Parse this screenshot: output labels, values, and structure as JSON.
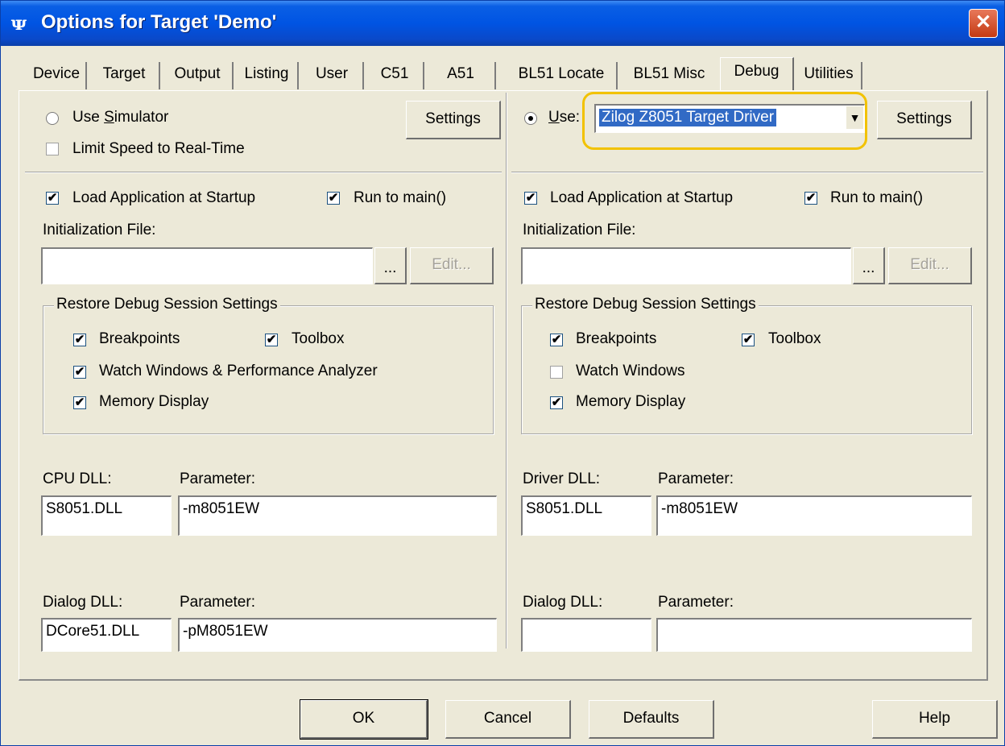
{
  "window": {
    "title": "Options for Target 'Demo'",
    "app_icon": "uv-icon",
    "close_glyph": "✕"
  },
  "tabs": [
    {
      "label": "Device"
    },
    {
      "label": "Target"
    },
    {
      "label": "Output"
    },
    {
      "label": "Listing"
    },
    {
      "label": "User"
    },
    {
      "label": "C51"
    },
    {
      "label": "A51"
    },
    {
      "label": "BL51 Locate"
    },
    {
      "label": "BL51 Misc"
    },
    {
      "label": "Debug",
      "active": true
    },
    {
      "label": "Utilities"
    }
  ],
  "left": {
    "use_simulator": {
      "label_pre": "Use ",
      "label_ul": "S",
      "label_post": "imulator",
      "selected": false
    },
    "limit_speed": {
      "label": "Limit Speed to Real-Time",
      "checked": false
    },
    "settings_button": "Settings",
    "load_app": {
      "label": "Load Application at Startup",
      "checked": true
    },
    "run_to_main": {
      "label": "Run to main()",
      "checked": true
    },
    "init_file_label": "Initialization File:",
    "init_file_value": "",
    "browse_button": "...",
    "edit_button": "Edit...",
    "restore_group": {
      "title": "Restore Debug Session Settings",
      "breakpoints": {
        "label": "Breakpoints",
        "checked": true
      },
      "toolbox": {
        "label": "Toolbox",
        "checked": true
      },
      "watch": {
        "label": "Watch Windows & Performance Analyzer",
        "checked": true
      },
      "memory": {
        "label": "Memory Display",
        "checked": true
      }
    },
    "cpu_dll_label": "CPU DLL:",
    "cpu_param_label": "Parameter:",
    "cpu_dll_value": "S8051.DLL",
    "cpu_param_value": "-m8051EW",
    "dialog_dll_label": "Dialog DLL:",
    "dialog_param_label": "Parameter:",
    "dialog_dll_value": "DCore51.DLL",
    "dialog_param_value": "-pM8051EW"
  },
  "right": {
    "use": {
      "label_ul": "U",
      "label_post": "se:",
      "selected": true
    },
    "driver_select": "Zilog Z8051 Target Driver",
    "settings_button": "Settings",
    "load_app": {
      "label": "Load Application at Startup",
      "checked": true
    },
    "run_to_main": {
      "label": "Run to main()",
      "checked": true
    },
    "init_file_label": "Initialization File:",
    "init_file_value": "",
    "browse_button": "...",
    "edit_button": "Edit...",
    "restore_group": {
      "title": "Restore Debug Session Settings",
      "breakpoints": {
        "label": "Breakpoints",
        "checked": true
      },
      "toolbox": {
        "label": "Toolbox",
        "checked": true
      },
      "watch": {
        "label": "Watch Windows",
        "checked": false
      },
      "memory": {
        "label": "Memory Display",
        "checked": true
      }
    },
    "driver_dll_label": "Driver DLL:",
    "driver_param_label": "Parameter:",
    "driver_dll_value": "S8051.DLL",
    "driver_param_value": "-m8051EW",
    "dialog_dll_label": "Dialog DLL:",
    "dialog_param_label": "Parameter:",
    "dialog_dll_value": "",
    "dialog_param_value": ""
  },
  "footer": {
    "ok": "OK",
    "cancel": "Cancel",
    "defaults": "Defaults",
    "help": "Help"
  },
  "check_glyph": "✔"
}
